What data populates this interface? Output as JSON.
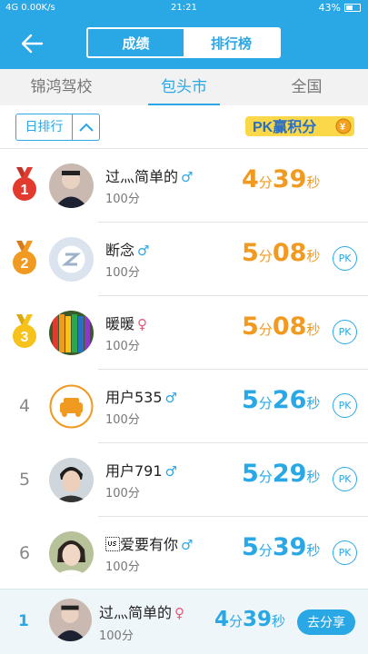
{
  "status": {
    "left": "4G  0.00K/s",
    "time": "21:21",
    "battery": "43%"
  },
  "header": {
    "segments": [
      "成绩",
      "排行榜"
    ],
    "active_segment": "排行榜"
  },
  "tabs": [
    {
      "label": "锦鸿驾校"
    },
    {
      "label": "包头市"
    },
    {
      "label": "全国"
    }
  ],
  "active_tab": "包头市",
  "filter": {
    "label": "日排行"
  },
  "pk_banner": {
    "text": "PK赢积分"
  },
  "entries": [
    {
      "rank": "1",
      "name": "过灬简单的",
      "gender": "♂",
      "score": "100分",
      "min": "4",
      "min_unit": "分",
      "sec": "39",
      "sec_unit": "秒"
    },
    {
      "rank": "2",
      "name": "断念",
      "gender": "♂",
      "score": "100分",
      "min": "5",
      "min_unit": "分",
      "sec": "08",
      "sec_unit": "秒",
      "pk": "PK"
    },
    {
      "rank": "3",
      "name": "暖暖",
      "gender": "♀",
      "score": "100分",
      "min": "5",
      "min_unit": "分",
      "sec": "08",
      "sec_unit": "秒",
      "pk": "PK"
    },
    {
      "rank": "4",
      "name": "用户535",
      "gender": "♂",
      "score": "100分",
      "min": "5",
      "min_unit": "分",
      "sec": "26",
      "sec_unit": "秒",
      "pk": "PK"
    },
    {
      "rank": "5",
      "name": "用户791",
      "gender": "♂",
      "score": "100分",
      "min": "5",
      "min_unit": "分",
      "sec": "29",
      "sec_unit": "秒",
      "pk": "PK"
    },
    {
      "rank": "6",
      "name": "\u001f爱要有你",
      "gender": "♂",
      "score": "100分",
      "min": "5",
      "min_unit": "分",
      "sec": "39",
      "sec_unit": "秒",
      "pk": "PK"
    }
  ],
  "me": {
    "rank": "1",
    "name": "过灬简单的",
    "gender": "♀",
    "score": "100分",
    "min": "4",
    "min_unit": "分",
    "sec": "39",
    "sec_unit": "秒",
    "share": "去分享"
  },
  "colors": {
    "primary": "#2aa8e6",
    "orange": "#f19a22",
    "gold": "#f6c21b",
    "red_medal": "#e23b2e"
  }
}
